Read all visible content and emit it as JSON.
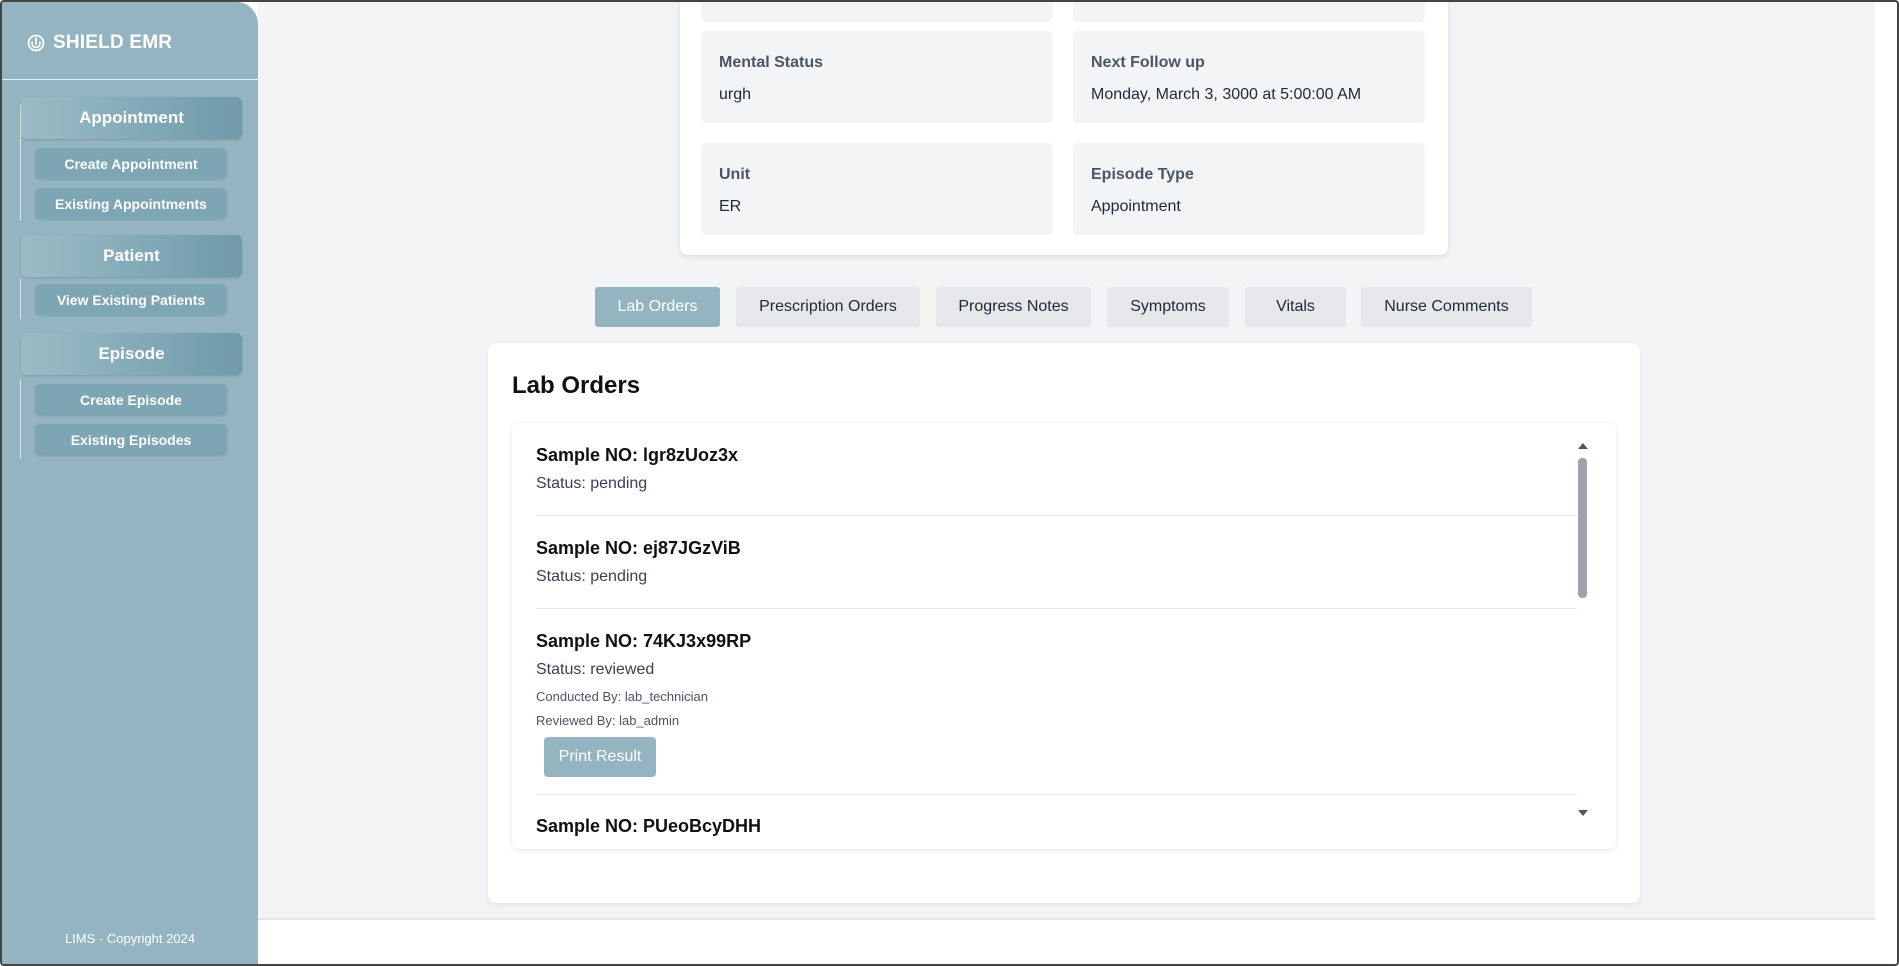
{
  "sidebar": {
    "brand": "SHIELD EMR",
    "brand_icon": "shield-logo-icon",
    "groups": [
      {
        "header": "Appointment",
        "buttons": [
          "Create Appointment",
          "Existing Appointments"
        ]
      },
      {
        "header": "Patient",
        "buttons": [
          "View Existing Patients"
        ]
      },
      {
        "header": "Episode",
        "buttons": [
          "Create Episode",
          "Existing Episodes"
        ]
      }
    ],
    "copyright": "LIMS - Copyright 2024",
    "colors": {
      "background": "#93b4c0",
      "button": "#7ea5b3"
    }
  },
  "episode_info": {
    "mental_status": {
      "label": "Mental Status",
      "value": "urgh"
    },
    "next_follow_up": {
      "label": "Next Follow up",
      "value": "Monday, March 3, 3000 at 5:00:00 AM"
    },
    "unit": {
      "label": "Unit",
      "value": "ER"
    },
    "episode_type": {
      "label": "Episode Type",
      "value": "Appointment"
    }
  },
  "tabs": {
    "active": "Lab Orders",
    "items": [
      "Lab Orders",
      "Prescription Orders",
      "Progress Notes",
      "Symptoms",
      "Vitals",
      "Nurse Comments"
    ]
  },
  "lab_orders": {
    "title": "Lab Orders",
    "orders": [
      {
        "sample": "Sample NO: lgr8zUoz3x",
        "status": "Status: pending"
      },
      {
        "sample": "Sample NO: ej87JGzViB",
        "status": "Status: pending"
      },
      {
        "sample": "Sample NO: 74KJ3x99RP",
        "status": "Status: reviewed",
        "conducted_by": "Conducted By: lab_technician",
        "reviewed_by": "Reviewed By: lab_admin",
        "action": "Print Result"
      },
      {
        "sample": "Sample NO: PUeoBcyDHH"
      }
    ]
  }
}
